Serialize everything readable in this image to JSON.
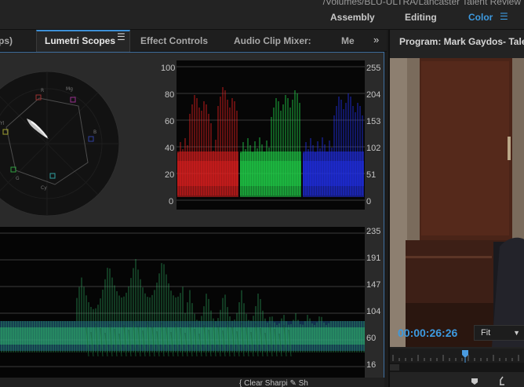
{
  "topbar": {
    "path": "/Volumes/BLU-ULTRA/Lancaster Talent Review",
    "workspaces": [
      "Assembly",
      "Editing",
      "Color"
    ],
    "active_workspace": "Color"
  },
  "left_panel": {
    "tabs": [
      "ps)",
      "Lumetri Scopes",
      "Effect Controls",
      "Audio Clip Mixer:",
      "Me"
    ],
    "active_tab": "Lumetri Scopes"
  },
  "vectorscope": {
    "targets": [
      "R",
      "Mg",
      "B",
      "Cy",
      "G",
      "Yl"
    ]
  },
  "parade": {
    "left_scale": [
      "100",
      "80",
      "60",
      "40",
      "20",
      "0"
    ],
    "right_scale": [
      "255",
      "204",
      "153",
      "102",
      "51",
      "0"
    ],
    "channels": [
      "red",
      "green",
      "blue"
    ]
  },
  "waveform": {
    "right_scale": [
      "235",
      "191",
      "147",
      "104",
      "60",
      "16"
    ]
  },
  "bottom_tools": {
    "label": "{ Clear Sharpi  ✎ Sh"
  },
  "program_monitor": {
    "title": "Program: Mark Gaydos- Talent",
    "timecode": "00:00:26:26",
    "fit": "Fit"
  },
  "colors": {
    "accent": "#3d9ae0",
    "panel_border": "#3f6fa0",
    "parade_red": "#e02020",
    "parade_green": "#22d34a",
    "parade_blue": "#2230e8"
  },
  "icons": [
    "panel-menu-icon",
    "overflow-chevrons-icon",
    "workspace-menu-icon",
    "dropdown-caret-icon",
    "playhead-icon",
    "marker-icon"
  ]
}
